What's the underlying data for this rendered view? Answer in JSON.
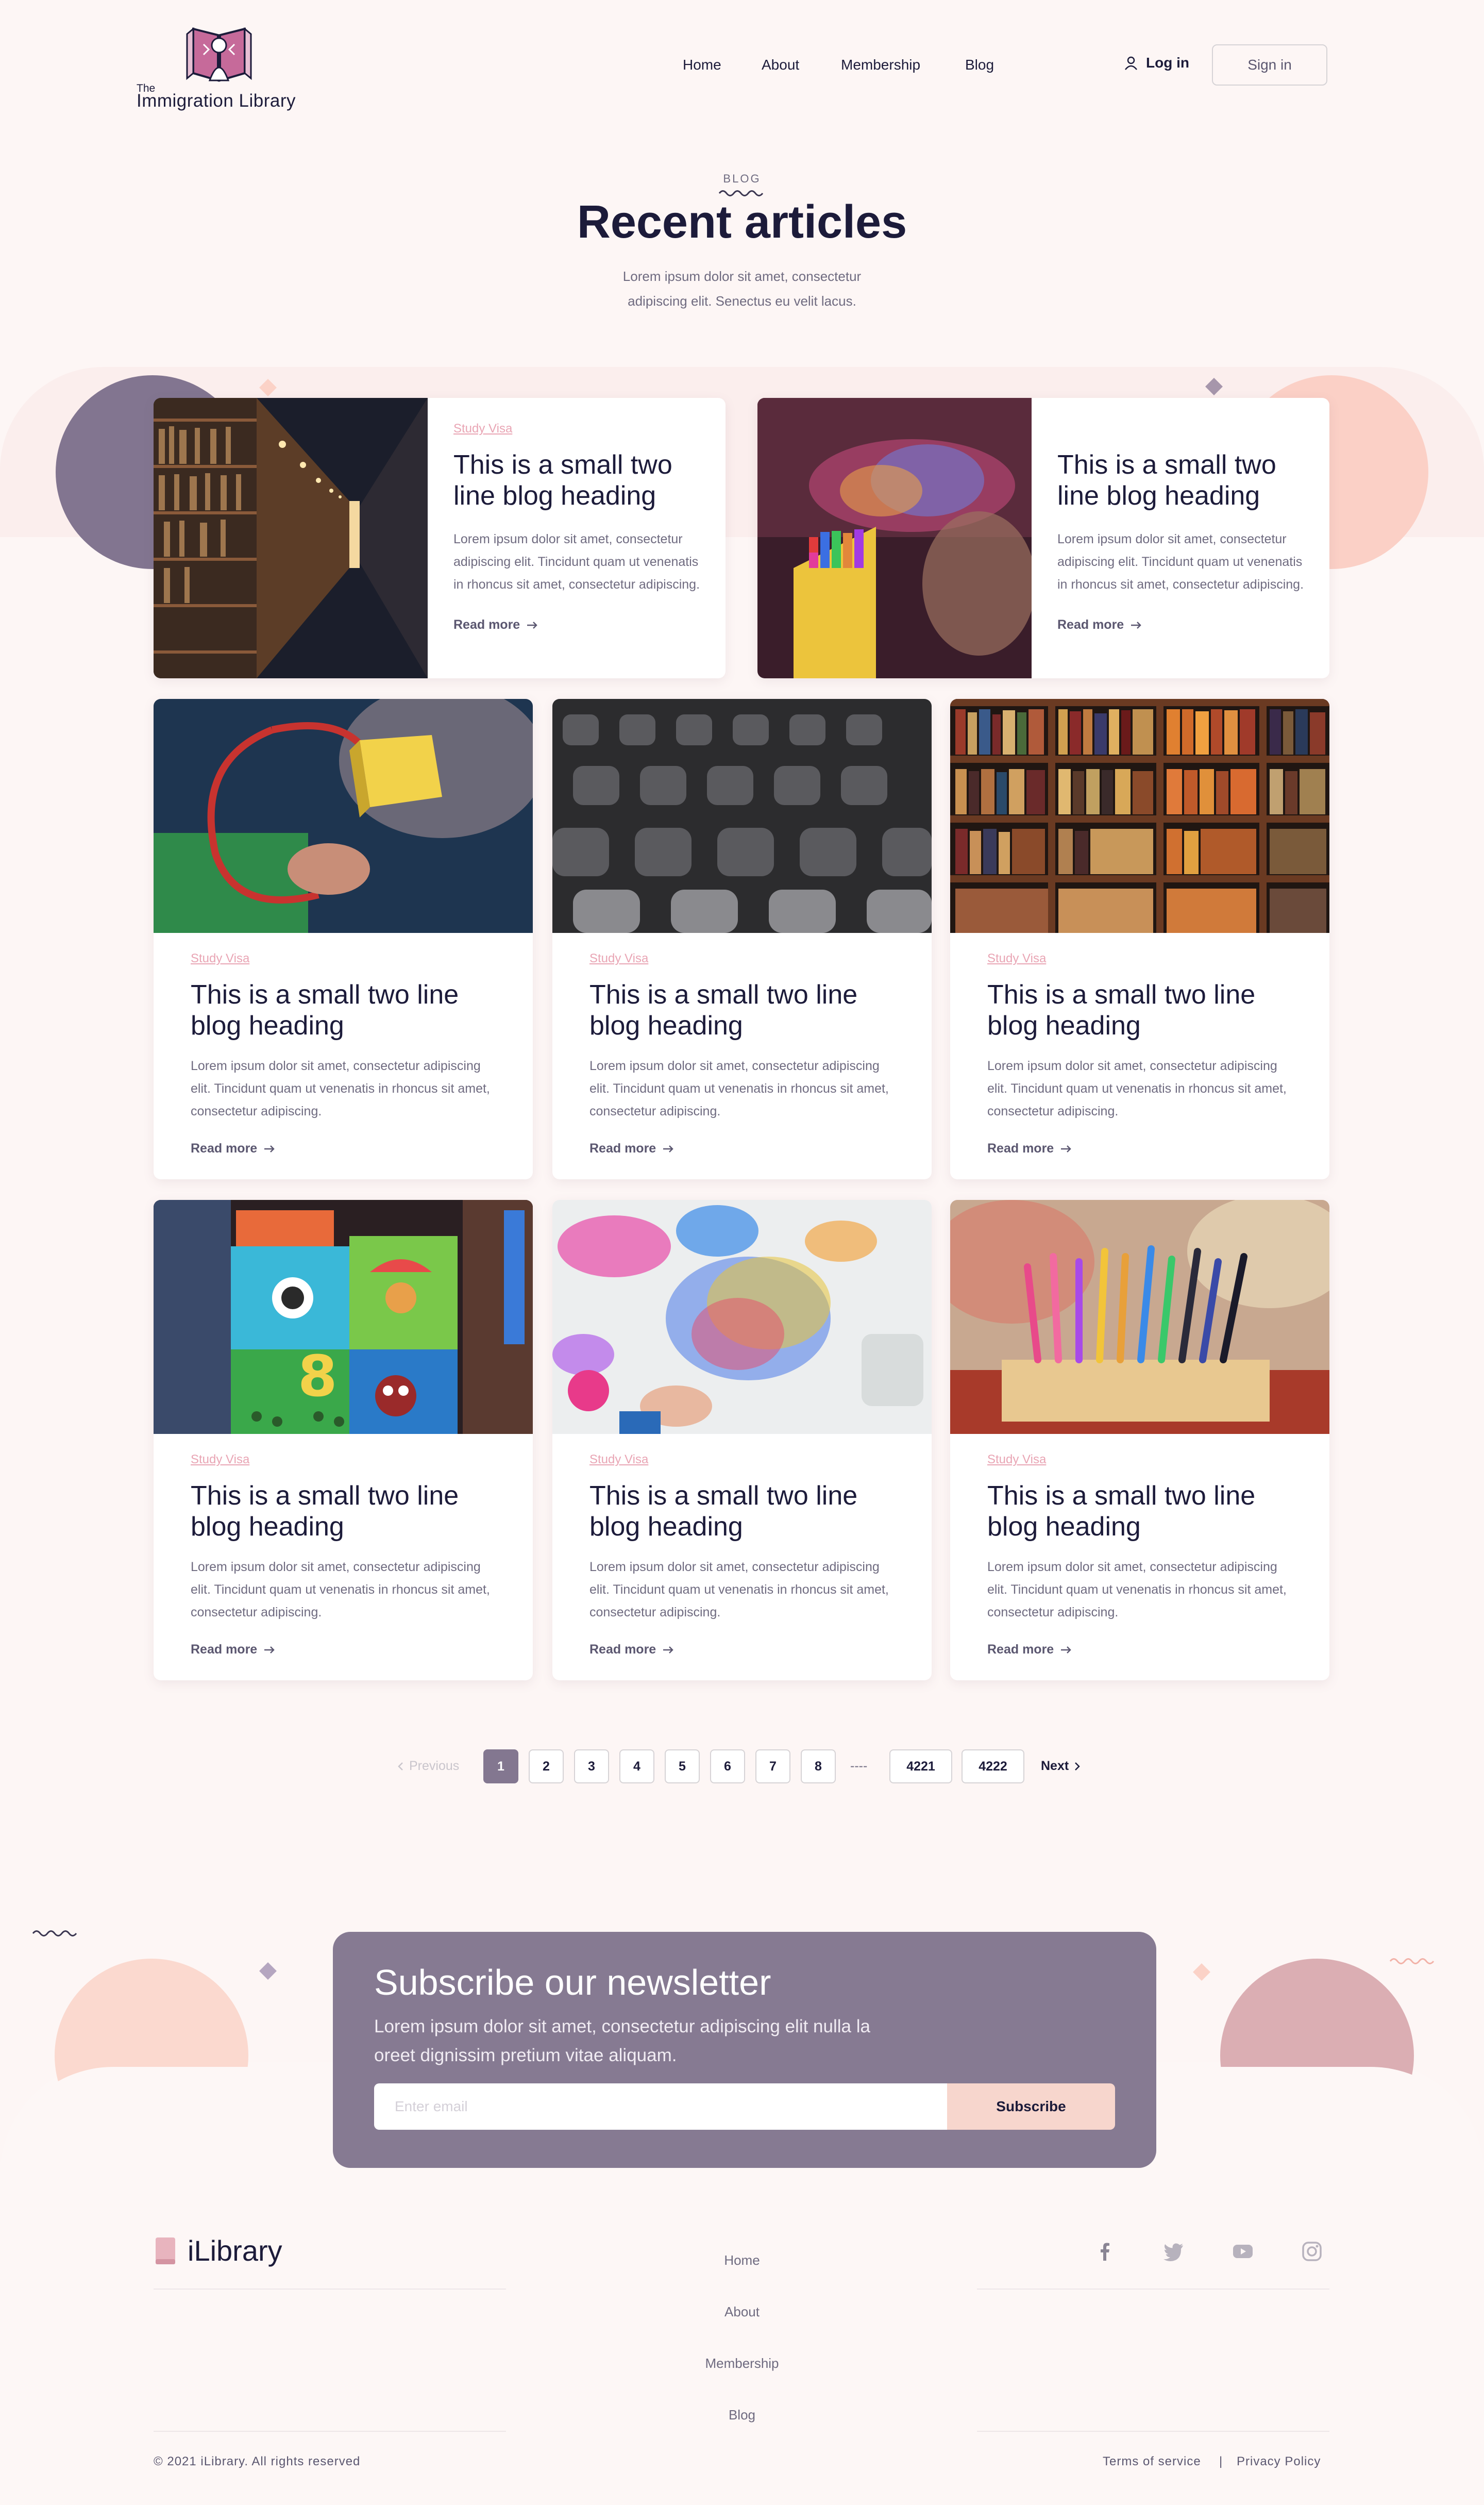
{
  "header": {
    "logo_the": "The",
    "logo_name": "Immigration Library",
    "nav": [
      "Home",
      "About",
      "Membership",
      "Blog"
    ],
    "login_label": "Log in",
    "signin_label": "Sign in"
  },
  "hero": {
    "eyebrow": "BLOG",
    "title": "Recent articles",
    "subtitle": "Lorem ipsum dolor sit amet, consectetur adipiscing elit. Senectus eu velit lacus."
  },
  "featured": [
    {
      "image": "library-corridor",
      "tag": "Study Visa",
      "title": "This is a small two line blog heading",
      "text": "Lorem ipsum dolor sit amet, consectetur adipiscing elit. Tincidunt quam ut venenatis in rhoncus sit amet, consectetur adipiscing.",
      "read_more": "Read more"
    },
    {
      "image": "crayons-cup",
      "tag": "",
      "title": "This is a small two line blog heading",
      "text": "Lorem ipsum dolor sit amet, consectetur adipiscing elit. Tincidunt quam ut venenatis in rhoncus sit amet, consectetur adipiscing.",
      "read_more": "Read more"
    }
  ],
  "articles": [
    {
      "image": "yellow-block",
      "tag": "Study Visa",
      "title": "This is a small two line blog heading",
      "text": "Lorem ipsum dolor sit amet, consectetur adipiscing elit. Tincidunt quam ut venenatis in rhoncus sit amet, consectetur adipiscing.",
      "read_more": "Read more"
    },
    {
      "image": "chairs",
      "tag": "Study Visa",
      "title": "This is a small two line blog heading",
      "text": "Lorem ipsum dolor sit amet, consectetur adipiscing elit. Tincidunt quam ut venenatis in rhoncus sit amet, consectetur adipiscing.",
      "read_more": "Read more"
    },
    {
      "image": "bookshelf",
      "tag": "Study Visa",
      "title": "This is a small two line blog heading",
      "text": "Lorem ipsum dolor sit amet, consectetur adipiscing elit. Tincidunt quam ut venenatis in rhoncus sit amet, consectetur adipiscing.",
      "read_more": "Read more"
    },
    {
      "image": "toy-blocks",
      "tag": "Study Visa",
      "title": "This is a small two line blog heading",
      "text": "Lorem ipsum dolor sit amet, consectetur adipiscing elit. Tincidunt quam ut venenatis in rhoncus sit amet, consectetur adipiscing.",
      "read_more": "Read more"
    },
    {
      "image": "painting",
      "tag": "Study Visa",
      "title": "This is a small two line blog heading",
      "text": "Lorem ipsum dolor sit amet, consectetur adipiscing elit. Tincidunt quam ut venenatis in rhoncus sit amet, consectetur adipiscing.",
      "read_more": "Read more"
    },
    {
      "image": "colored-pencils",
      "tag": "Study Visa",
      "title": "This is a small two line blog heading",
      "text": "Lorem ipsum dolor sit amet, consectetur adipiscing elit. Tincidunt quam ut venenatis in rhoncus sit amet, consectetur adipiscing.",
      "read_more": "Read more"
    }
  ],
  "pagination": {
    "previous": "Previous",
    "pages": [
      "1",
      "2",
      "3",
      "4",
      "5",
      "6",
      "7",
      "8"
    ],
    "ellipsis": "----",
    "last_pages": [
      "4221",
      "4222"
    ],
    "next": "Next",
    "current": "1"
  },
  "newsletter": {
    "title": "Subscribe our newsletter",
    "text": "Lorem ipsum dolor sit amet, consectetur adipiscing elit nulla la oreet dignissim pretium vitae aliquam.",
    "placeholder": "Enter email",
    "button": "Subscribe"
  },
  "footer": {
    "logo": "iLibrary",
    "nav": [
      "Home",
      "About",
      "Membership",
      "Blog"
    ],
    "social": [
      "facebook-icon",
      "twitter-icon",
      "youtube-icon",
      "instagram-icon"
    ],
    "copyright": "© 2021 iLibrary. All rights reserved",
    "terms": "Terms of service",
    "separator": "|",
    "privacy": "Privacy Policy"
  },
  "colors": {
    "background": "#fdf6f5",
    "accent_purple": "#867a92",
    "accent_peach": "#f7d6cd",
    "tag_pink": "#e9a5b4",
    "heading": "#1c1b3a"
  }
}
